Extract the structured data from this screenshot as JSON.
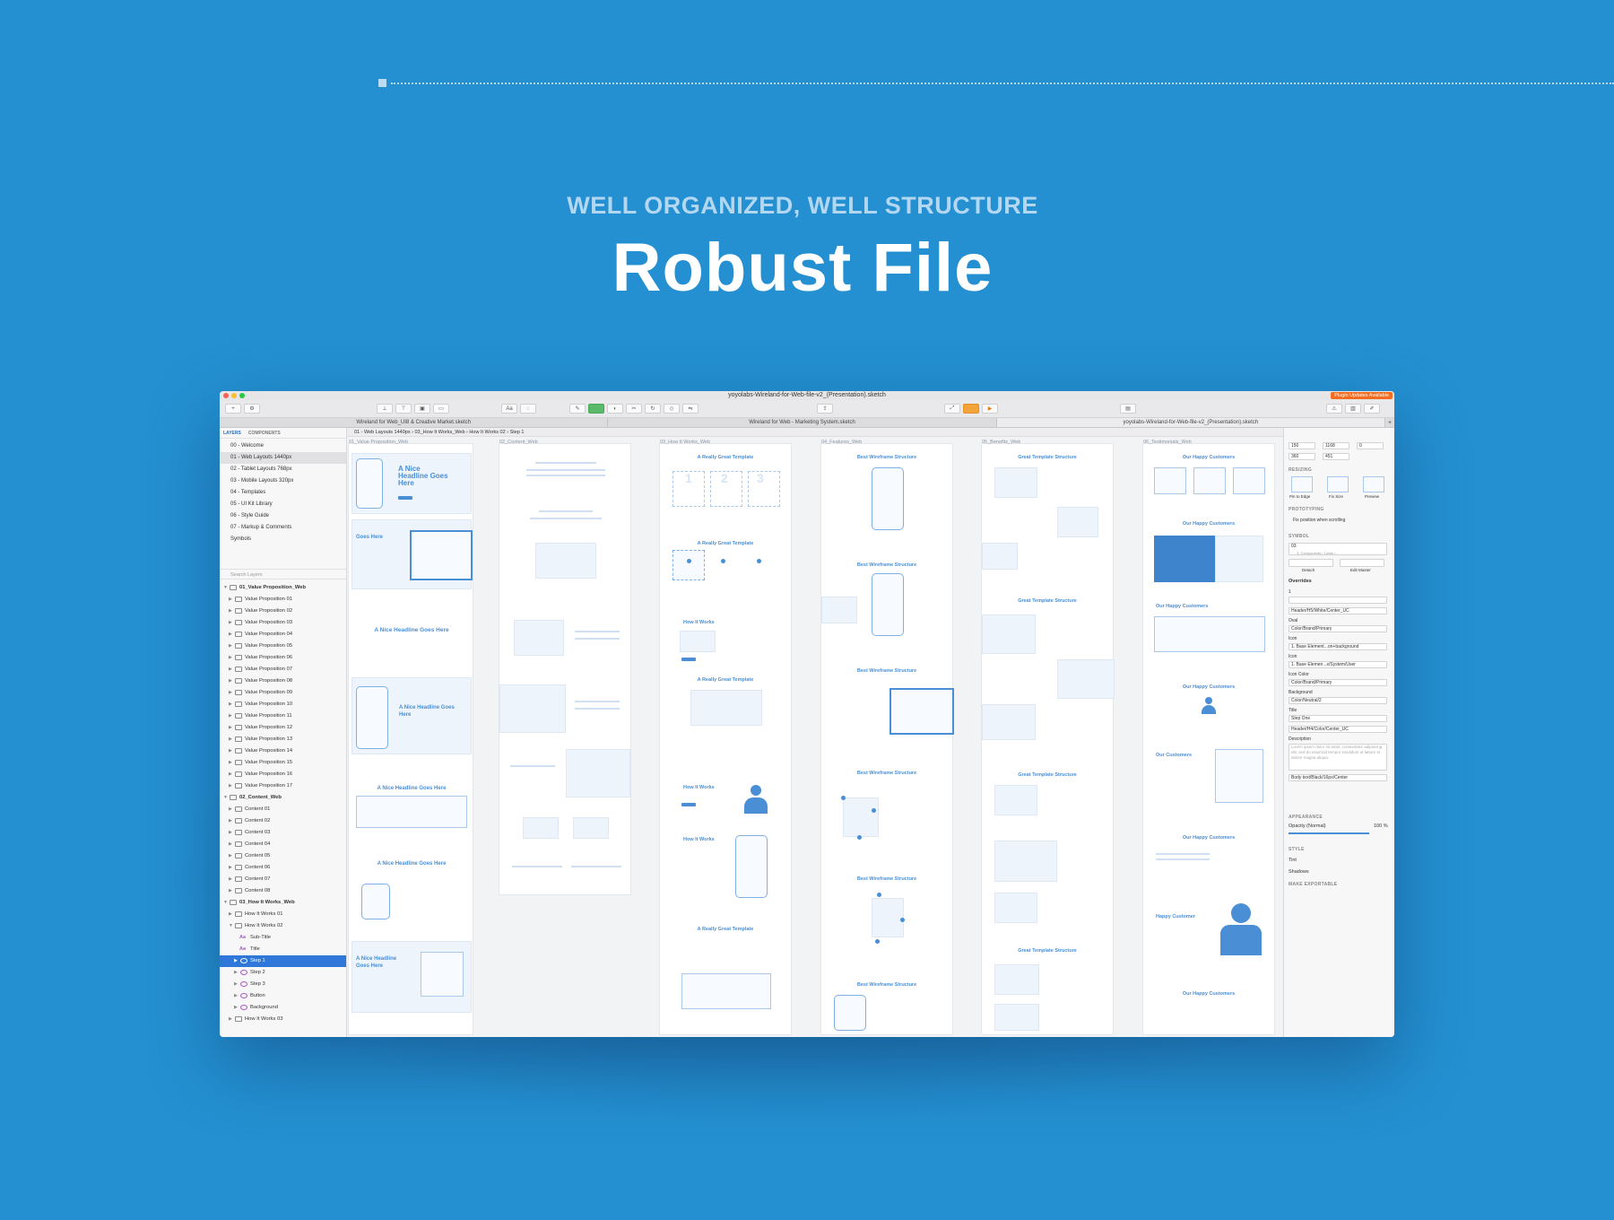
{
  "header": {
    "eyebrow": "WELL ORGANIZED, WELL STRUCTURE",
    "title": "Robust File"
  },
  "app": {
    "window_title": "yoyolabs-Wireland-for-Web-file-v2_(Presentation).sketch",
    "plugin_badge": "Plugin Updates Available",
    "tabs": [
      "Wireland for Web_UI8 & Creative Market.sketch",
      "Wireland for Web - Marketing System.sketch",
      "yoyolabs-Wireland-for-Web-file-v2_(Presentation).sketch"
    ],
    "breadcrumb": [
      "01 - Web Layouts 1440px",
      "03_How It Works_Web",
      "How It Works 02",
      "Step 1"
    ]
  },
  "layers_panel": {
    "tab_layers": "LAYERS",
    "tab_components": "COMPONENTS",
    "pages": [
      "00 - Welcome",
      "01 - Web Layouts 1440px",
      "02 - Tablet Layouts 768px",
      "03 - Mobile Layouts 320px",
      "04 - Templates",
      "05 - UI Kit Library",
      "06 - Style Guide",
      "07 - Markup & Comments",
      "Symbols"
    ],
    "search_placeholder": "Search Layers",
    "groups": [
      {
        "name": "01_Value Proposition_Web",
        "items": [
          "Value Proposition 01",
          "Value Proposition 02",
          "Value Proposition 03",
          "Value Proposition 04",
          "Value Proposition 05",
          "Value Proposition 06",
          "Value Proposition 07",
          "Value Proposition 08",
          "Value Proposition 09",
          "Value Proposition 10",
          "Value Proposition 11",
          "Value Proposition 12",
          "Value Proposition 13",
          "Value Proposition 14",
          "Value Proposition 15",
          "Value Proposition 16",
          "Value Proposition 17"
        ]
      },
      {
        "name": "02_Content_Web",
        "items": [
          "Content 01",
          "Content 02",
          "Content 03",
          "Content 04",
          "Content 05",
          "Content 06",
          "Content 07",
          "Content 08"
        ]
      },
      {
        "name": "03_How It Works_Web",
        "items": [
          "How It Works 01",
          "How It Works 02"
        ]
      }
    ],
    "expanded_children": [
      "Sub-Title",
      "Title",
      "Step 1",
      "Step 2",
      "Step 3",
      "Button",
      "Background",
      "How It Works 03"
    ]
  },
  "artboards": [
    {
      "label": "01_Value Proposition_Web",
      "texts": [
        "A Nice Headline Goes Here",
        "Goes Here",
        "A Nice Headline Goes Here",
        "A Nice Headline Goes Here",
        "A Nice Headline Goes Here",
        "A Nice Headline Goes Here",
        "A Nice Headline Goes Here"
      ]
    },
    {
      "label": "02_Content_Web"
    },
    {
      "label": "03_How It Works_Web",
      "texts": [
        "A Really Great Template",
        "A Really Great Template",
        "How It Works",
        "A Really Great Template",
        "How It Works",
        "How It Works",
        "A Really Great Template"
      ]
    },
    {
      "label": "04_Features_Web",
      "texts": [
        "Best Wireframe Structure",
        "Best Wireframe Structure",
        "Best Wireframe Structure",
        "Best Wireframe Structure",
        "Best Wireframe Structure",
        "Best Wireframe Structure"
      ]
    },
    {
      "label": "05_Benefits_Web",
      "texts": [
        "Great Template Structure",
        "Great Template Structure",
        "Great Template Structure",
        "Great Template Structure"
      ]
    },
    {
      "label": "06_Testimonials_Web",
      "texts": [
        "Our Happy Customers",
        "Our Happy Customers",
        "Our Happy Customers",
        "Our Happy Customers",
        "Our Customers",
        "Our Happy Customers",
        "Happy Customer",
        "Our Happy Customers"
      ]
    }
  ],
  "inspector": {
    "x": "150",
    "y": "1168",
    "rotation": "0",
    "w": "360",
    "h": "451",
    "resizing": "RESIZING",
    "resize_options": [
      "Pin to Edge",
      "Fix Size",
      "Preview"
    ],
    "prototyping": "PROTOTYPING",
    "fix_position": "Fix position when scrolling",
    "symbol": "SYMBOL",
    "symbol_name": "03",
    "symbol_path": "3. Components / Cards /...",
    "detach": "Detach",
    "edit_master": "Edit Master",
    "overrides": "Overrides",
    "override_rows": [
      {
        "label": "1",
        "value": ""
      },
      {
        "label": "",
        "value": "Header/H5/White/Center_UC"
      },
      {
        "label": "Oval",
        "value": "Color/Brand/Primary"
      },
      {
        "label": "Icon",
        "value": "1. Base Element...on+background"
      },
      {
        "label": "Icon",
        "value": "1. Base Elemen...s/System/User"
      },
      {
        "label": "Icon Color",
        "value": "Color/Brand/Primary"
      },
      {
        "label": "Background",
        "value": "Color/Neutral/2"
      },
      {
        "label": "Title",
        "value": "Step One"
      },
      {
        "label": "",
        "value": "Header/H4/Color/Center_UC"
      },
      {
        "label": "Description",
        "value": "Lorem ipsum dolor sit amet, consectetur adipiscing elit, sed do eiusmod tempor incididunt ut labore et dolore magna aliqua."
      },
      {
        "label": "",
        "value": "Body text/Black/16px/Center"
      }
    ],
    "appearance": "APPEARANCE",
    "opacity_label": "Opacity (Normal)",
    "opacity_value": "100 %",
    "style": "STYLE",
    "tint": "Tint",
    "shadows": "Shadows",
    "make_exportable": "MAKE EXPORTABLE"
  },
  "colors": {
    "background": "#2490d1",
    "brand_primary": "#4a8fd6",
    "selection": "#2f77d9"
  }
}
